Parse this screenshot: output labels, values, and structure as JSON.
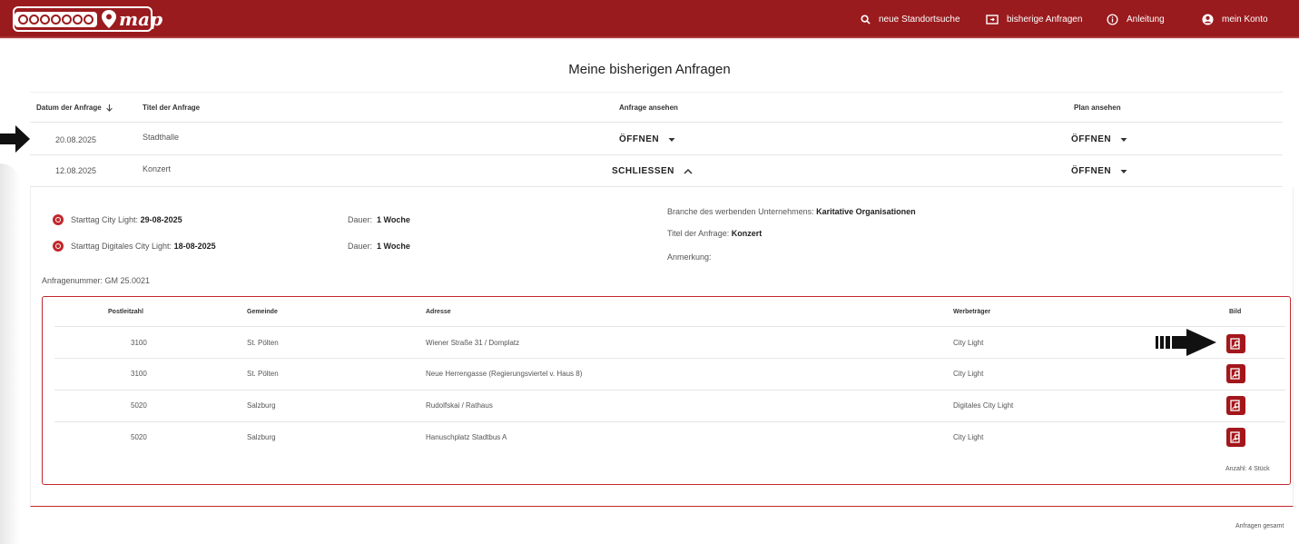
{
  "brand": {
    "name": "map",
    "accent": "#9a1b1e"
  },
  "nav": {
    "search": {
      "label": "neue Standortsuche",
      "icon": "search-icon"
    },
    "history": {
      "label": "bisherige Anfragen",
      "icon": "folder-icon"
    },
    "guide": {
      "label": "Anleitung",
      "icon": "info-icon"
    },
    "account": {
      "label": "mein Konto",
      "icon": "account-icon"
    }
  },
  "page": {
    "title": "Meine bisherigen Anfragen"
  },
  "table": {
    "headers": {
      "date": "Datum der Anfrage",
      "title": "Titel der Anfrage",
      "view_request": "Anfrage ansehen",
      "view_plan": "Plan ansehen"
    },
    "rows": [
      {
        "date": "20.08.2025",
        "title": "Stadthalle",
        "request_action": "ÖFFNEN",
        "plan_action": "ÖFFNEN"
      },
      {
        "date": "12.08.2025",
        "title": "Konzert",
        "request_action": "SCHLIESSEN",
        "plan_action": "ÖFFNEN"
      }
    ]
  },
  "detail": {
    "start_city_light_label": "Starttag City Light:",
    "start_city_light_value": "29-08-2025",
    "start_digital_label": "Starttag Digitales City Light:",
    "start_digital_value": "18-08-2025",
    "duration_label": "Dauer:",
    "duration_1": "1 Woche",
    "duration_2": "1 Woche",
    "industry_label": "Branche des werbenden Unternehmens:",
    "industry_value": "Karitative Organisationen",
    "title_label": "Titel der Anfrage:",
    "title_value": "Konzert",
    "note_label": "Anmerkung:",
    "request_number": "Anfragenummer: GM 25.0021",
    "columns": {
      "zip": "Postleitzahl",
      "municipality": "Gemeinde",
      "address": "Adresse",
      "medium": "Werbeträger",
      "image": "Bild"
    },
    "locations": [
      {
        "zip": "3100",
        "municipality": "St. Pölten",
        "address": "Wiener Straße 31 / Domplatz",
        "medium": "City Light"
      },
      {
        "zip": "3100",
        "municipality": "St. Pölten",
        "address": "Neue Herrengasse (Regierungsviertel v. Haus 8)",
        "medium": "City Light"
      },
      {
        "zip": "5020",
        "municipality": "Salzburg",
        "address": "Rudolfskai / Rathaus",
        "medium": "Digitales City Light"
      },
      {
        "zip": "5020",
        "municipality": "Salzburg",
        "address": "Hanuschplatz Stadtbus A",
        "medium": "City Light"
      }
    ],
    "count": "Anzahl: 4 Stück"
  },
  "footer": {
    "total": "Anfragen gesamt"
  }
}
